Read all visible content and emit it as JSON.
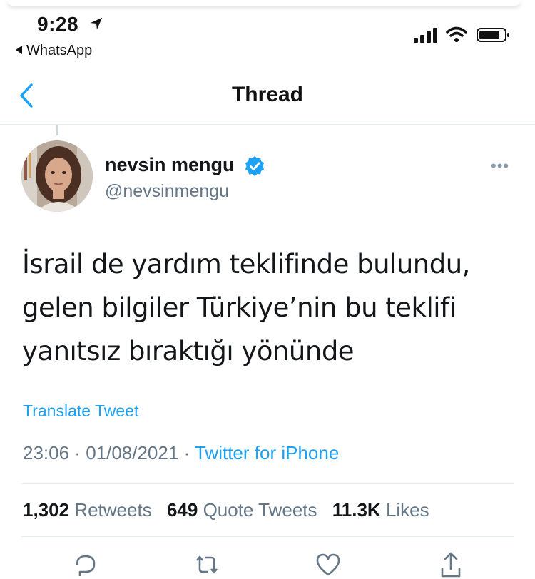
{
  "status_bar": {
    "time": "9:28",
    "back_app": "WhatsApp",
    "icons": [
      "location-arrow-icon",
      "signal-icon",
      "wifi-icon",
      "battery-icon"
    ]
  },
  "nav": {
    "title": "Thread",
    "back_icon": "chevron-left-icon"
  },
  "tweet": {
    "display_name": "nevsin mengu",
    "handle": "@nevsinmengu",
    "verified": true,
    "more_label": "•••",
    "text_lines": [
      "İsrail de yardım teklifinde bulundu,",
      "gelen bilgiler Türkiye’nin bu teklifi",
      "yanıtsız bıraktığı yönünde"
    ],
    "translate_label": "Translate Tweet",
    "time": "23:06",
    "date": "01/08/2021",
    "source": "Twitter for iPhone",
    "separator": " · ",
    "stats": {
      "retweets_count": "1,302",
      "retweets_label": "Retweets",
      "quotes_count": "649",
      "quotes_label": "Quote Tweets",
      "likes_count": "11.3K",
      "likes_label": "Likes"
    }
  },
  "actions": [
    "reply-icon",
    "retweet-icon",
    "like-icon",
    "share-icon"
  ],
  "colors": {
    "accent": "#1da1f2",
    "secondary_text": "#657786",
    "primary_text": "#14171a",
    "divider": "#e6ecf0"
  }
}
